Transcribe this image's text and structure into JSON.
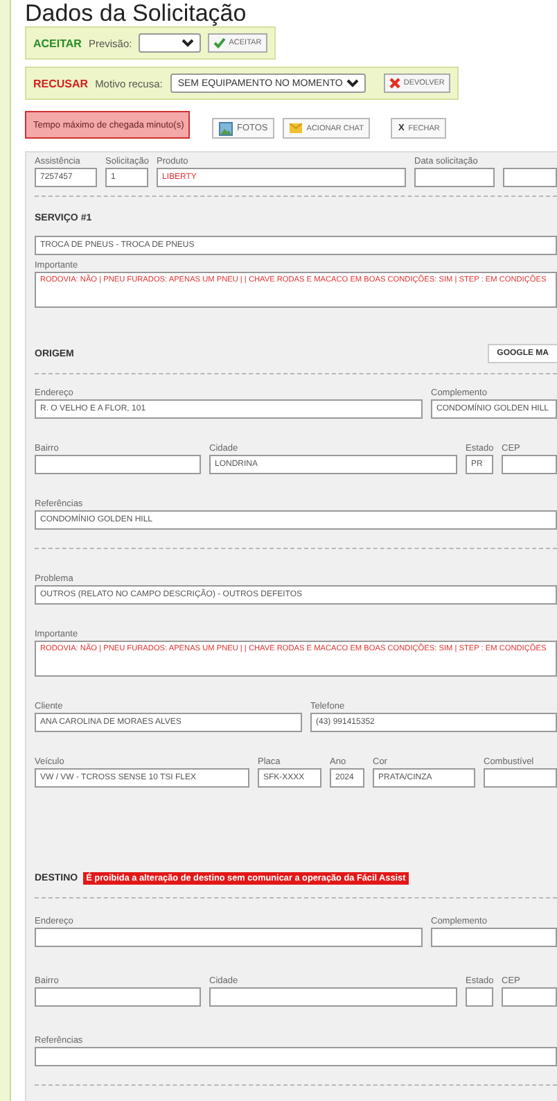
{
  "title": "Dados da Solicitação",
  "accept_bar": {
    "label": "ACEITAR",
    "field_label": "Previsão:",
    "button": "ACEITAR"
  },
  "refuse_bar": {
    "label": "RECUSAR",
    "field_label": "Motivo recusa:",
    "select_value": "SEM EQUIPAMENTO NO MOMENTO",
    "button": "DEVOLVER"
  },
  "alert": "Tempo máximo de chegada minuto(s)",
  "actions": [
    {
      "kind": "photo",
      "label": "FOTOS"
    },
    {
      "kind": "chat",
      "label": "ACIONAR CHAT"
    },
    {
      "kind": "close",
      "glyph": "X",
      "label": "FECHAR"
    }
  ],
  "sections": [
    {
      "kind": "header",
      "rows": [
        {
          "kind": "header",
          "fields": [
            {
              "label": "Assistência",
              "value": "7257457",
              "highlighted": false
            },
            {
              "label": "Solicitação",
              "value": "1",
              "highlighted": false
            },
            {
              "label": "Produto",
              "value": "LIBERTY",
              "highlighted": true
            },
            {
              "label": "Data solicitação"
            }
          ]
        }
      ]
    },
    {
      "kind": "service",
      "heading": "SERVIÇO #1",
      "rows": [
        {
          "kind": "full",
          "fields": [
            {
              "value": "TROCA DE PNEUS - TROCA DE PNEUS",
              "highlighted": false
            }
          ]
        },
        {
          "kind": "textarea",
          "fields": [
            {
              "label": "Importante",
              "value": "RODOVIA: NÃO | PNEU FURADOS: APENAS UM PNEU |   | CHAVE RODAS E MACACO EM BOAS CONDIÇÕES: SIM | STEP : EM CONDIÇÕES",
              "highlighted": true
            }
          ]
        }
      ]
    },
    {
      "kind": "location",
      "heading": "ORIGEM",
      "map_button": "GOOGLE MA",
      "rows": [
        {
          "kind": "address",
          "fields": [
            {
              "label": "Endereço",
              "value": "R. O VELHO E A FLOR, 101",
              "highlighted": false
            },
            {
              "label": "Complemento",
              "value": "CONDOMÍNIO GOLDEN HILL",
              "highlighted": false
            }
          ]
        },
        {
          "kind": "locality",
          "fields": [
            {
              "label": "Bairro"
            },
            {
              "label": "Cidade",
              "value": "LONDRINA",
              "highlighted": false
            },
            {
              "label": "Estado",
              "value": "PR",
              "highlighted": false
            },
            {
              "label": "CEP"
            }
          ]
        },
        {
          "kind": "full",
          "fields": [
            {
              "label": "Referências",
              "value": "CONDOMÍNIO GOLDEN HILL",
              "highlighted": false
            }
          ]
        }
      ]
    },
    {
      "kind": "details",
      "rows": [
        {
          "kind": "full",
          "fields": [
            {
              "label": "Problema",
              "value": "OUTROS (RELATO NO CAMPO DESCRIÇÃO) - OUTROS DEFEITOS",
              "highlighted": false
            }
          ]
        },
        {
          "kind": "textarea",
          "fields": [
            {
              "label": "Importante",
              "value": "RODOVIA: NÃO | PNEU FURADOS: APENAS UM PNEU |   | CHAVE RODAS E MACACO EM BOAS CONDIÇÕES: SIM | STEP : EM CONDIÇÕES",
              "highlighted": true
            }
          ]
        },
        {
          "kind": "client",
          "fields": [
            {
              "label": "Cliente",
              "value": "ANA CAROLINA DE MORAES ALVES",
              "highlighted": false
            },
            {
              "label": "Telefone",
              "value": "(43) 991415352",
              "highlighted": false
            }
          ]
        },
        {
          "kind": "vehicle",
          "fields": [
            {
              "label": "Veículo",
              "value": "VW / VW - TCROSS SENSE 10 TSI FLEX",
              "highlighted": false
            },
            {
              "label": "Placa",
              "value": "SFK-XXXX",
              "highlighted": false
            },
            {
              "label": "Ano",
              "value": "2024",
              "highlighted": false
            },
            {
              "label": "Cor",
              "value": "PRATA/CINZA",
              "highlighted": false
            },
            {
              "label": "Combustível"
            }
          ]
        }
      ]
    },
    {
      "kind": "location",
      "heading": "DESTINO",
      "badge": "É proibida a alteração de destino sem comunicar a operação da Fácil Assist",
      "rows": [
        {
          "kind": "address",
          "fields": [
            {
              "label": "Endereço"
            },
            {
              "label": "Complemento"
            }
          ]
        },
        {
          "kind": "locality",
          "fields": [
            {
              "label": "Bairro"
            },
            {
              "label": "Cidade"
            },
            {
              "label": "Estado"
            },
            {
              "label": "CEP"
            }
          ]
        },
        {
          "kind": "full",
          "fields": [
            {
              "label": "Referências"
            }
          ]
        }
      ]
    }
  ]
}
